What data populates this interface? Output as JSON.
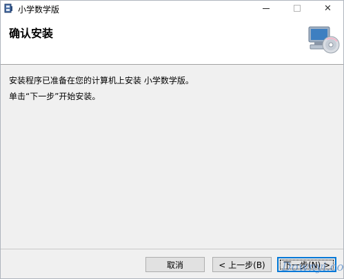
{
  "window": {
    "title": "小学数学版",
    "icon": "installer-box-icon"
  },
  "header": {
    "title": "确认安装",
    "icon": "computer-disc-icon"
  },
  "body": {
    "line1": "安装程序已准备在您的计算机上安装 小学数学版。",
    "line2": "单击“下一步”开始安装。"
  },
  "buttons": {
    "cancel": "取消",
    "back": "< 上一步(B)",
    "next": "下一步(N) >"
  },
  "watermark": "Downyi.com"
}
